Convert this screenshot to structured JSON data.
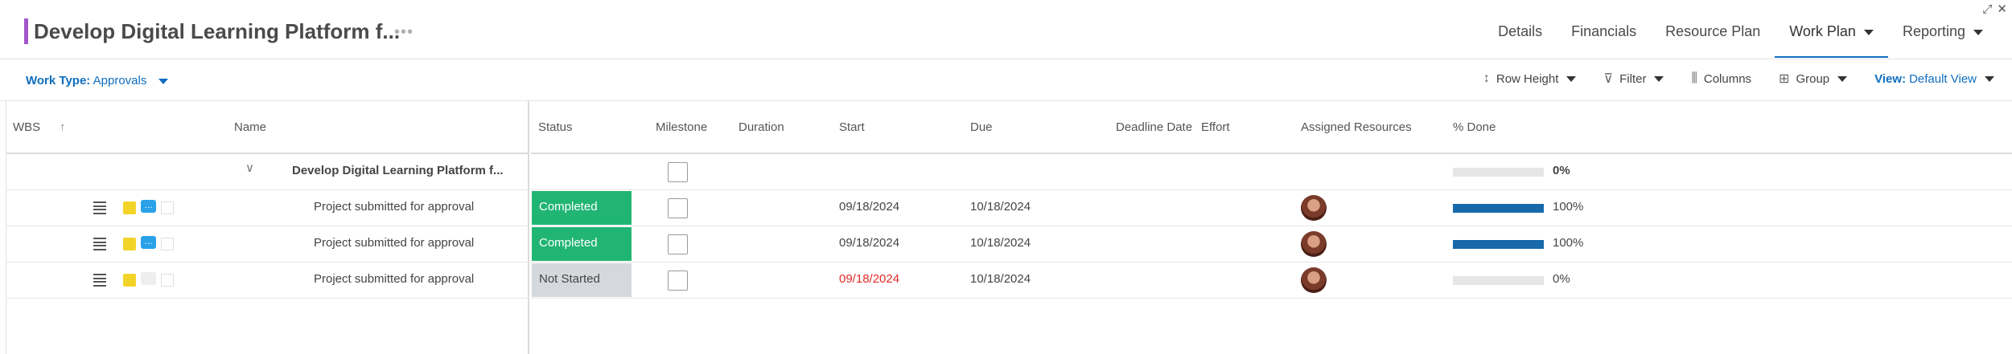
{
  "header": {
    "title": "Develop Digital Learning Platform f...",
    "more_label": "•••",
    "restore_icon": "restore-icon",
    "close_icon": "close-icon"
  },
  "tabs": [
    {
      "label": "Details",
      "dropdown": false,
      "active": false
    },
    {
      "label": "Financials",
      "dropdown": false,
      "active": false
    },
    {
      "label": "Resource Plan",
      "dropdown": false,
      "active": false
    },
    {
      "label": "Work Plan",
      "dropdown": true,
      "active": true
    },
    {
      "label": "Reporting",
      "dropdown": true,
      "active": false
    }
  ],
  "toolbar": {
    "work_type_label": "Work Type:",
    "work_type_value": "Approvals",
    "row_height": "Row Height",
    "filter": "Filter",
    "columns": "Columns",
    "group": "Group",
    "view_label": "View:",
    "view_value": "Default View"
  },
  "columns": {
    "wbs": "WBS",
    "name": "Name",
    "status": "Status",
    "milestone": "Milestone",
    "duration": "Duration",
    "start": "Start",
    "due": "Due",
    "deadline": "Deadline Date",
    "effort": "Effort",
    "resources": "Assigned Resources",
    "done": "% Done"
  },
  "summary_row": {
    "name": "Develop Digital Learning Platform f...",
    "percent_done": 0,
    "percent_label": "0%"
  },
  "rows": [
    {
      "name": "Project submitted for approval",
      "status": "Completed",
      "start": "09/18/2024",
      "start_overdue": false,
      "due": "10/18/2024",
      "percent_done": 100,
      "percent_label": "100%",
      "has_comment": true
    },
    {
      "name": "Project submitted for approval",
      "status": "Completed",
      "start": "09/18/2024",
      "start_overdue": false,
      "due": "10/18/2024",
      "percent_done": 100,
      "percent_label": "100%",
      "has_comment": true
    },
    {
      "name": "Project submitted for approval",
      "status": "Not Started",
      "start": "09/18/2024",
      "start_overdue": true,
      "due": "10/18/2024",
      "percent_done": 0,
      "percent_label": "0%",
      "has_comment": false
    }
  ],
  "colors": {
    "accent": "#a259c9",
    "link": "#106ebe",
    "completed": "#21b573",
    "not_started": "#d5d8dc",
    "progress": "#1769aa",
    "overdue": "#e02b27"
  }
}
